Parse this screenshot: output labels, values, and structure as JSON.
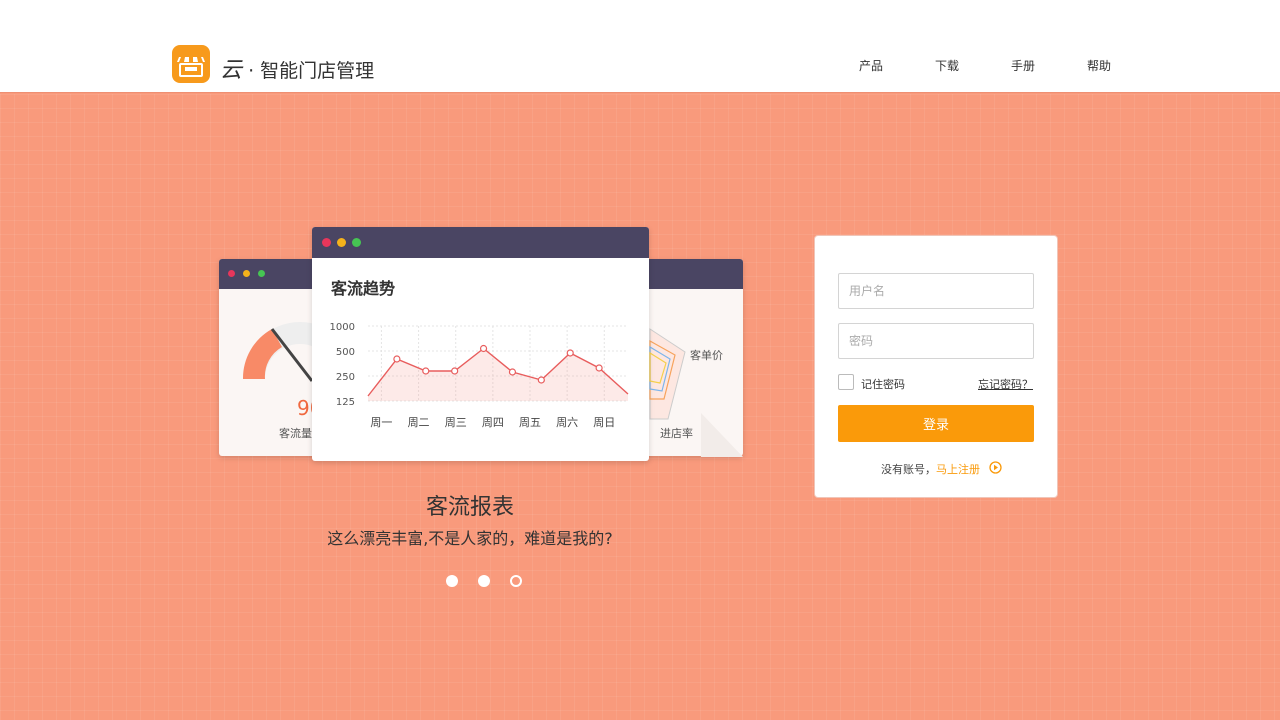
{
  "header": {
    "logo_mark": "云",
    "logo_sep": "·",
    "brand_name": "智能门店管理",
    "nav": [
      "产品",
      "下载",
      "手册",
      "帮助"
    ]
  },
  "colors": {
    "accent": "#fa9a0a",
    "background": "#f99a7c",
    "window_bar": "#4a4563",
    "line": "#e85d5d"
  },
  "hero": {
    "gauge_value": "90",
    "gauge_label": "客流量",
    "radar_label_1": "客单价",
    "radar_label_2": "进店率",
    "title": "客流报表",
    "subtitle": "这么漂亮丰富,不是人家的，难道是我的?",
    "page_dots": 3,
    "active_dot": 2
  },
  "chart_data": {
    "type": "line",
    "title": "客流趋势",
    "categories": [
      "周一",
      "周二",
      "周三",
      "周四",
      "周五",
      "周六",
      "周日"
    ],
    "yticks": [
      "1000",
      "500",
      "250",
      "125"
    ],
    "series": [
      {
        "values": [
          150,
          420,
          300,
          300,
          550,
          290,
          230,
          480,
          330,
          160
        ]
      }
    ]
  },
  "login": {
    "username_placeholder": "用户名",
    "password_placeholder": "密码",
    "remember_label": "记住密码",
    "forgot_label": "忘记密码？",
    "submit_label": "登录",
    "no_account_text": "没有账号，",
    "register_label": "马上注册"
  }
}
